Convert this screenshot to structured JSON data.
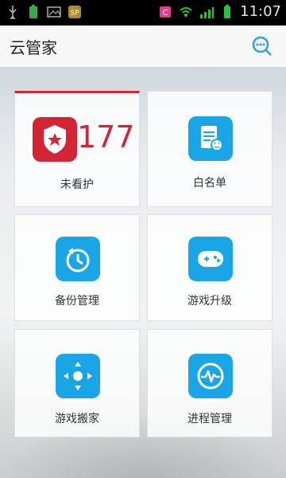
{
  "status_bar": {
    "time": "11:07",
    "icons": [
      "usb-icon",
      "battery-small-icon",
      "image-icon",
      "app-icon",
      "sim-icon",
      "wifi-icon",
      "signal-icon",
      "battery-icon"
    ]
  },
  "header": {
    "title": "云管家",
    "search_icon": "search-icon"
  },
  "tiles": [
    {
      "label": "未看护",
      "count": "177",
      "icon": "shield-star-icon",
      "accent": "#d32434"
    },
    {
      "label": "白名单",
      "icon": "notepad-smile-icon",
      "accent": "#1aa6e6"
    },
    {
      "label": "备份管理",
      "icon": "backup-clock-icon",
      "accent": "#1aa6e6"
    },
    {
      "label": "游戏升级",
      "icon": "gamepad-icon",
      "accent": "#1aa6e6"
    },
    {
      "label": "游戏搬家",
      "icon": "move-arrows-icon",
      "accent": "#1aa6e6"
    },
    {
      "label": "进程管理",
      "icon": "process-pulse-icon",
      "accent": "#1aa6e6"
    }
  ]
}
